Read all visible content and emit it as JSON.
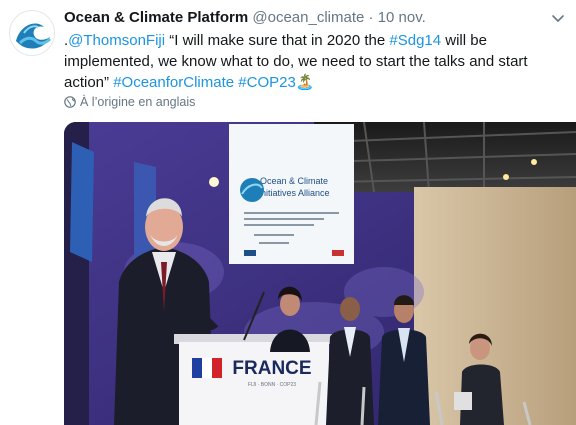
{
  "tweet": {
    "author_name": "Ocean & Climate Platform",
    "author_handle": "@ocean_climate",
    "separator": "·",
    "timestamp": "10 nov.",
    "text_prefix": ".",
    "mention": "@ThomsonFiji",
    "quote_part1": " “I will make sure that in 2020 the ",
    "hashtag_sdg": "#Sdg14",
    "quote_part2": " will be implemented, we know what to do, we need to start the talks and start action” ",
    "hashtag_ocean": "#OceanforClimate",
    "space": " ",
    "hashtag_cop": "#COP23",
    "emoji": "🏝️",
    "translate_label": "À l’origine en anglais"
  },
  "photo": {
    "screen_title_line1": "Ocean & Climate",
    "screen_title_line2": "Initiatives Alliance",
    "podium_text": "FRANCE",
    "podium_subtext": "FIJI · BONN · COP23"
  },
  "colors": {
    "link": "#1b95e0",
    "secondary_text": "#657786",
    "stage_purple": "#3a2d7a",
    "podium_white": "#f5f5f7"
  }
}
